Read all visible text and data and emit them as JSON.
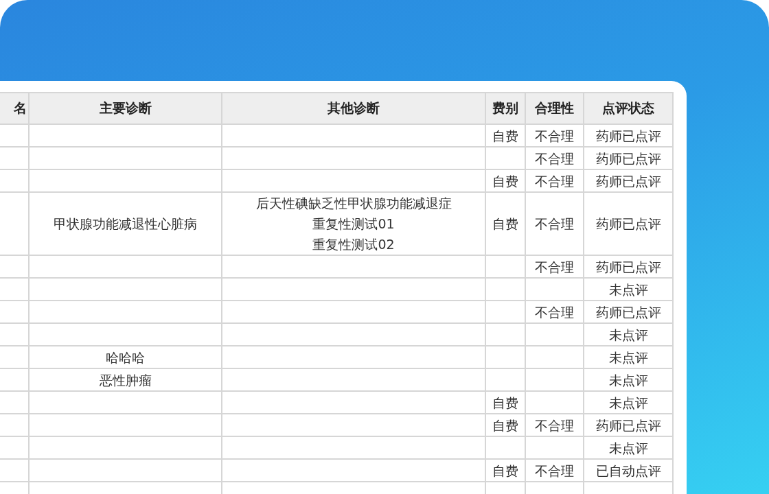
{
  "table": {
    "columns": [
      "名",
      "主要诊断",
      "其他诊断",
      "费别",
      "合理性",
      "点评状态"
    ],
    "rows": [
      {
        "fee": "自费",
        "rationality": "不合理",
        "review_status": "药师已点评"
      },
      {
        "rationality": "不合理",
        "review_status": "药师已点评"
      },
      {
        "fee": "自费",
        "rationality": "不合理",
        "review_status": "药师已点评"
      },
      {
        "primary_diagnosis": "甲状腺功能减退性心脏病",
        "other_diagnoses": [
          "后天性碘缺乏性甲状腺功能减退症",
          "重复性测试01",
          "重复性测试02"
        ],
        "fee": "自费",
        "rationality": "不合理",
        "review_status": "药师已点评"
      },
      {
        "rationality": "不合理",
        "review_status": "药师已点评"
      },
      {
        "review_status": "未点评"
      },
      {
        "rationality": "不合理",
        "review_status": "药师已点评"
      },
      {
        "review_status": "未点评"
      },
      {
        "primary_diagnosis": "哈哈哈",
        "review_status": "未点评"
      },
      {
        "primary_diagnosis": "恶性肿瘤",
        "review_status": "未点评"
      },
      {
        "fee": "自费",
        "review_status": "未点评"
      },
      {
        "fee": "自费",
        "rationality": "不合理",
        "review_status": "药师已点评"
      },
      {
        "review_status": "未点评"
      },
      {
        "fee": "自费",
        "rationality": "不合理",
        "review_status": "已自动点评"
      },
      {}
    ]
  }
}
